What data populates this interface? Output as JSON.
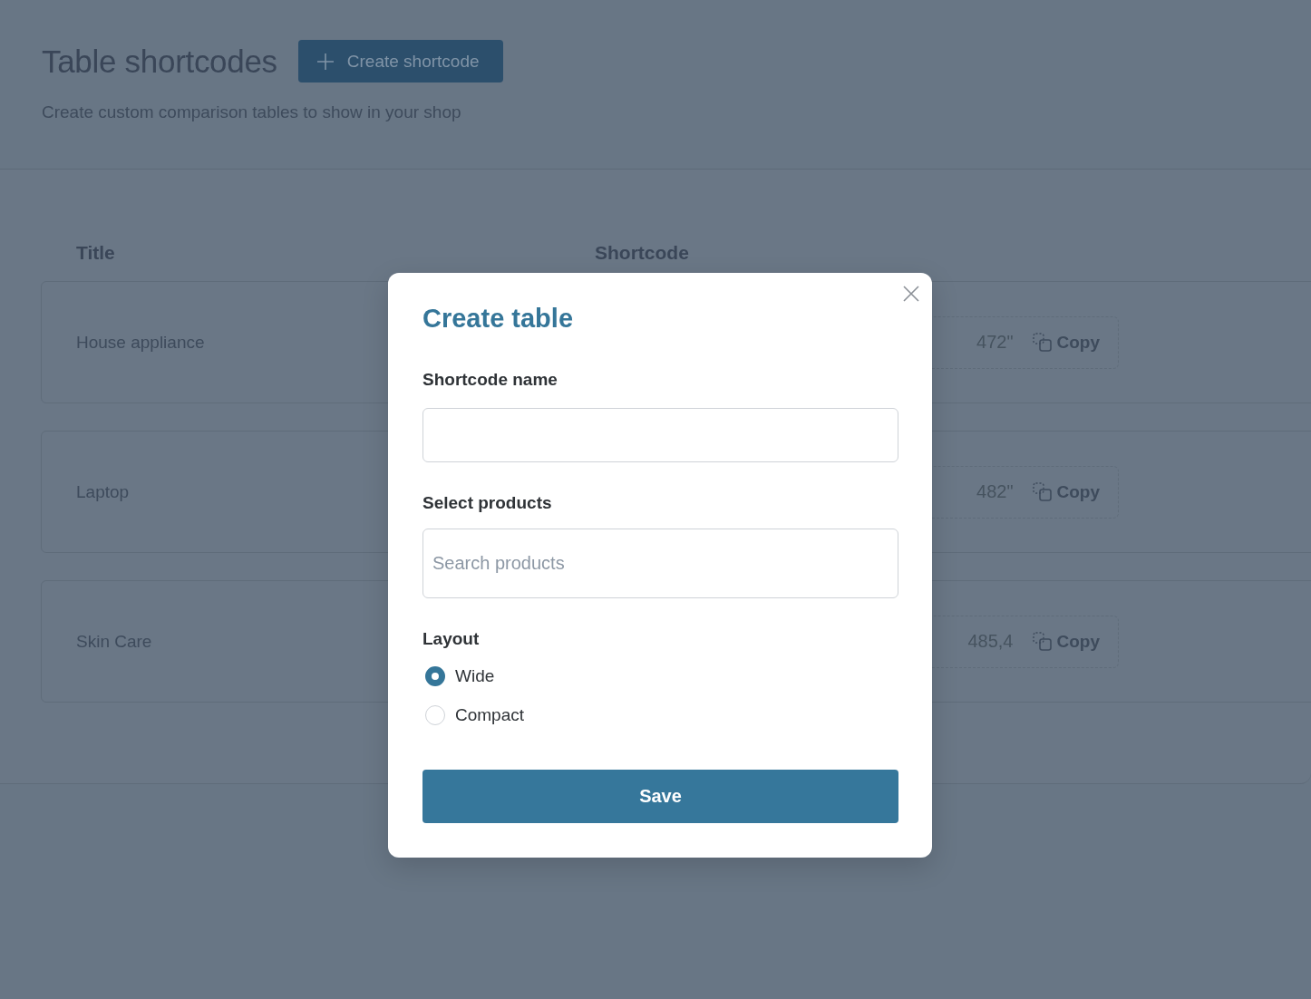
{
  "page": {
    "title": "Table shortcodes",
    "create_button": "Create shortcode",
    "subtitle": "Create custom comparison tables to show in your shop"
  },
  "table": {
    "columns": [
      "Title",
      "Shortcode"
    ],
    "rows": [
      {
        "title": "House appliance",
        "shortcode": "472\"",
        "copy": "Copy"
      },
      {
        "title": "Laptop",
        "shortcode": "482\"",
        "copy": "Copy"
      },
      {
        "title": "Skin Care",
        "shortcode": "485,4",
        "copy": "Copy"
      }
    ]
  },
  "modal": {
    "title": "Create table",
    "name_label": "Shortcode name",
    "products_label": "Select products",
    "products_search": {
      "placeholder": "Search products"
    },
    "layout_label": "Layout",
    "layout_options": [
      {
        "label": "Wide",
        "selected": true
      },
      {
        "label": "Compact",
        "selected": false
      }
    ],
    "save_button": "Save"
  }
}
